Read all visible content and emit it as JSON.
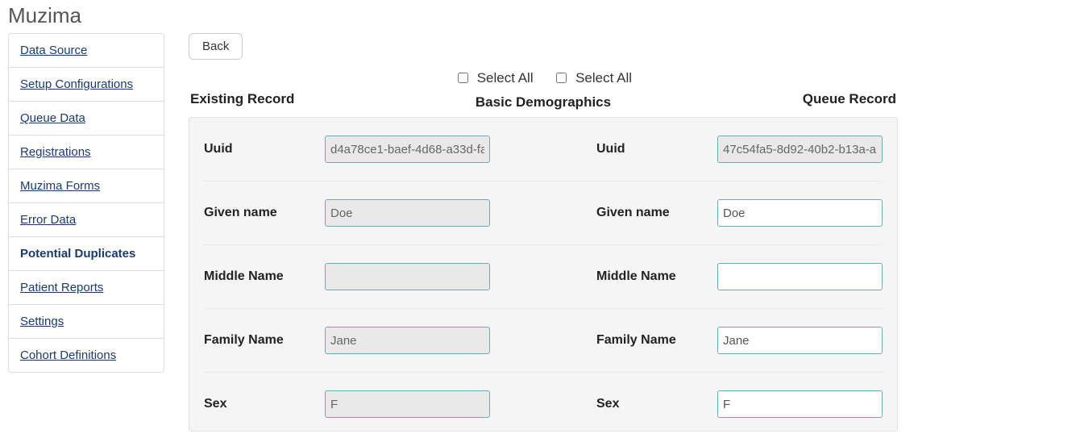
{
  "page_title": "Muzima",
  "sidebar": {
    "items": [
      {
        "label": "Data Source"
      },
      {
        "label": "Setup Configurations"
      },
      {
        "label": "Queue Data"
      },
      {
        "label": "Registrations"
      },
      {
        "label": "Muzima Forms"
      },
      {
        "label": "Error Data"
      },
      {
        "label": "Potential Duplicates"
      },
      {
        "label": "Patient Reports"
      },
      {
        "label": "Settings"
      },
      {
        "label": "Cohort Definitions"
      }
    ],
    "active_index": 6
  },
  "back_label": "Back",
  "select_all_left": "Select All",
  "select_all_right": "Select All",
  "existing_record_label": "Existing Record",
  "queue_record_label": "Queue Record",
  "section_title": "Basic Demographics",
  "fields": {
    "uuid": {
      "label": "Uuid",
      "existing": "d4a78ce1-baef-4d68-a33d-fa",
      "queue": "47c54fa5-8d92-40b2-b13a-a"
    },
    "given_name": {
      "label": "Given name",
      "existing": "Doe",
      "queue": "Doe"
    },
    "middle_name": {
      "label": "Middle Name",
      "existing": "",
      "queue": ""
    },
    "family_name": {
      "label": "Family Name",
      "existing": "Jane",
      "queue": "Jane"
    },
    "sex": {
      "label": "Sex",
      "existing": "F",
      "queue": "F"
    }
  }
}
